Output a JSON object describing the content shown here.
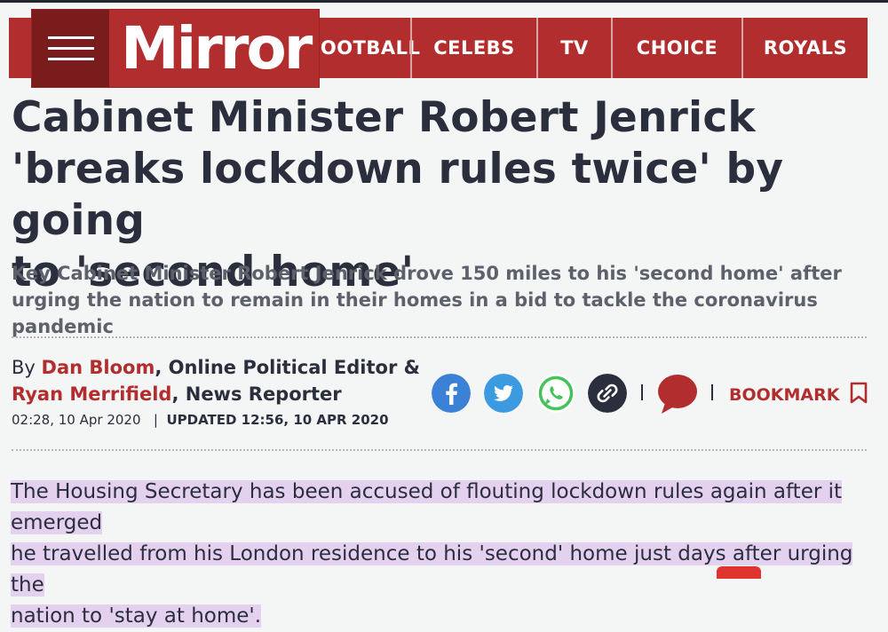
{
  "nav": {
    "items": [
      "FOOTBALL",
      "CELEBS",
      "TV",
      "CHOICE",
      "ROYALS"
    ],
    "logo": "Mirror"
  },
  "article": {
    "headline_lines": [
      "Cabinet Minister Robert Jenrick",
      "'breaks lockdown rules twice' by going",
      "to 'second home'"
    ],
    "standfirst": "Key Cabinet Minister Robert Jenrick drove 150 miles to his 'second home' after urging the nation to remain in their homes in a bid to tackle the coronavirus pandemic",
    "byline": {
      "by": "By ",
      "author1": "Dan Bloom",
      "role1": ", Online Political Editor &",
      "author2": "Ryan Merrifield",
      "role2": ", News Reporter"
    },
    "published": "02:28, 10 Apr 2020",
    "updated": "UPDATED 12:56, 10 APR 2020",
    "body_lines": [
      "The Housing Secretary has been accused of flouting lockdown rules again after it emerged",
      "he travelled from his London residence to his 'second' home just days after urging the",
      "nation to 'stay at home'."
    ]
  },
  "share": {
    "icons": [
      "facebook-icon",
      "twitter-icon",
      "whatsapp-icon",
      "link-icon",
      "comment-icon",
      "bookmark-icon"
    ],
    "bookmark_label": "BOOKMARK"
  },
  "colors": {
    "brand_red": "#b22d2d",
    "facebook": "#3b82d6",
    "twitter": "#3b9ae0",
    "whatsapp": "#45c35a",
    "link": "#2b2f3d",
    "highlight": "#e4d0ef"
  }
}
